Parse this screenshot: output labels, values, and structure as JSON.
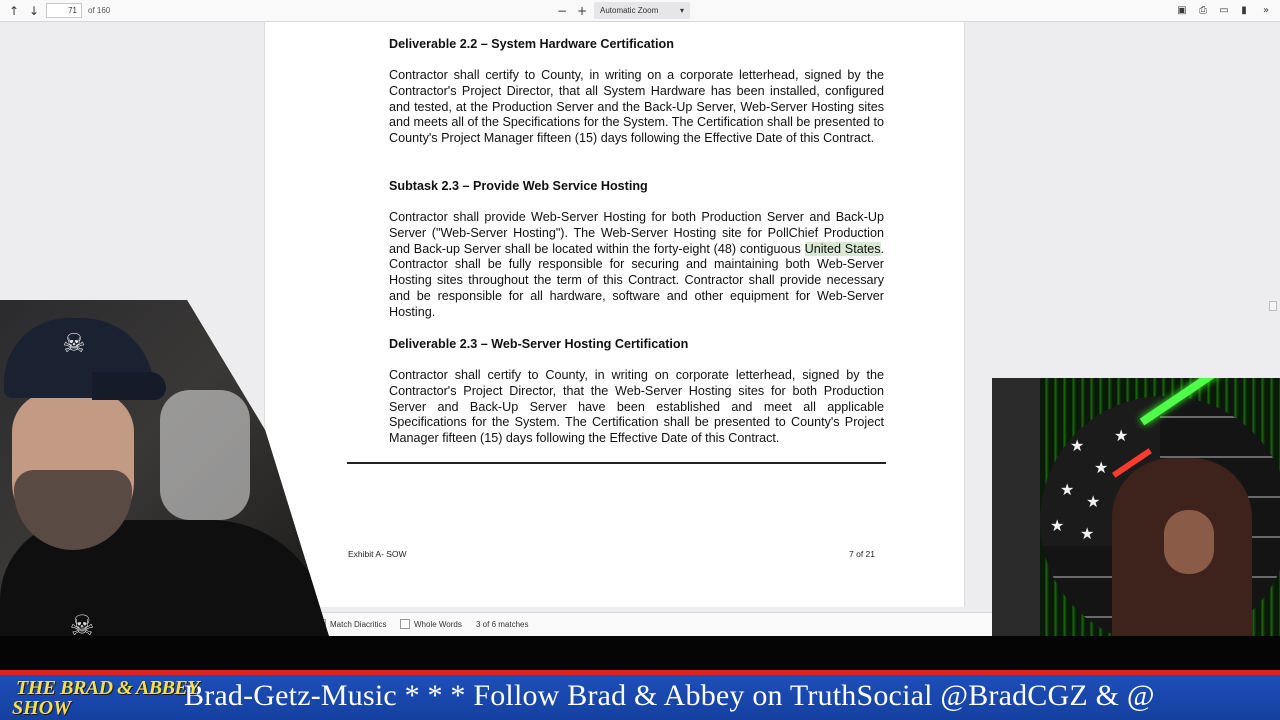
{
  "toolbar": {
    "page_number": "71",
    "page_count": "of 160",
    "zoom_label": "Automatic Zoom",
    "icons": [
      "arrow-up-icon",
      "arrow-down-icon",
      "zoom-out-icon",
      "zoom-in-icon",
      "chevron-down-icon",
      "presentation-icon",
      "print-icon",
      "open-file-icon",
      "bookmark-icon",
      "more-icon"
    ]
  },
  "document": {
    "sections": [
      {
        "heading": "Deliverable 2.2 – System Hardware Certification",
        "body": "Contractor shall certify to County, in writing on a corporate letterhead, signed by the Contractor's Project Director, that all System Hardware has been installed, configured and tested, at the Production Server and the Back-Up Server, Web-Server Hosting sites and meets all of the Specifications for the System. The Certification shall be presented to County's Project Manager fifteen (15) days following the Effective Date of this Contract."
      },
      {
        "heading": "Subtask 2.3 – Provide Web Service Hosting",
        "body_before": "Contractor shall provide Web-Server Hosting for both Production Server and Back-Up Server (\"Web-Server Hosting\").  The Web-Server Hosting site for PollChief Production and Back-up Server shall be located within the forty-eight (48) contiguous ",
        "highlight": "United States",
        "body_after": ". Contractor shall be fully responsible for securing and maintaining both Web-Server Hosting sites throughout the term of this Contract.  Contractor shall provide necessary and be responsible for all hardware, software and other equipment for Web-Server Hosting."
      },
      {
        "heading": "Deliverable 2.3 – Web-Server Hosting Certification",
        "body": "Contractor shall certify to County, in writing on corporate letterhead, signed by the Contractor's Project Director, that the Web-Server Hosting sites for both Production Server and Back-Up Server have been established and meet all applicable Specifications for the System. The Certification shall be presented to County's Project Manager fifteen (15) days following the Effective Date of this Contract."
      }
    ],
    "footer_left": "Exhibit A- SOW",
    "footer_right": "7 of 21"
  },
  "findbar": {
    "match_diacritics": "Match Diacritics",
    "whole_words": "Whole Words",
    "match_count": "3 of 6 matches"
  },
  "overlay": {
    "logo_line1": "THE BRAD & ABBEY",
    "logo_line2": "SHOW",
    "ticker": "Brad-Getz-Music * * * Follow Brad & Abbey on TruthSocial @BradCGZ & @"
  },
  "colors": {
    "highlight": "#d9e9d3",
    "ticker_blue": "#1d4fb8",
    "ticker_red": "#d8261d",
    "logo_yellow": "#f6e04a"
  }
}
